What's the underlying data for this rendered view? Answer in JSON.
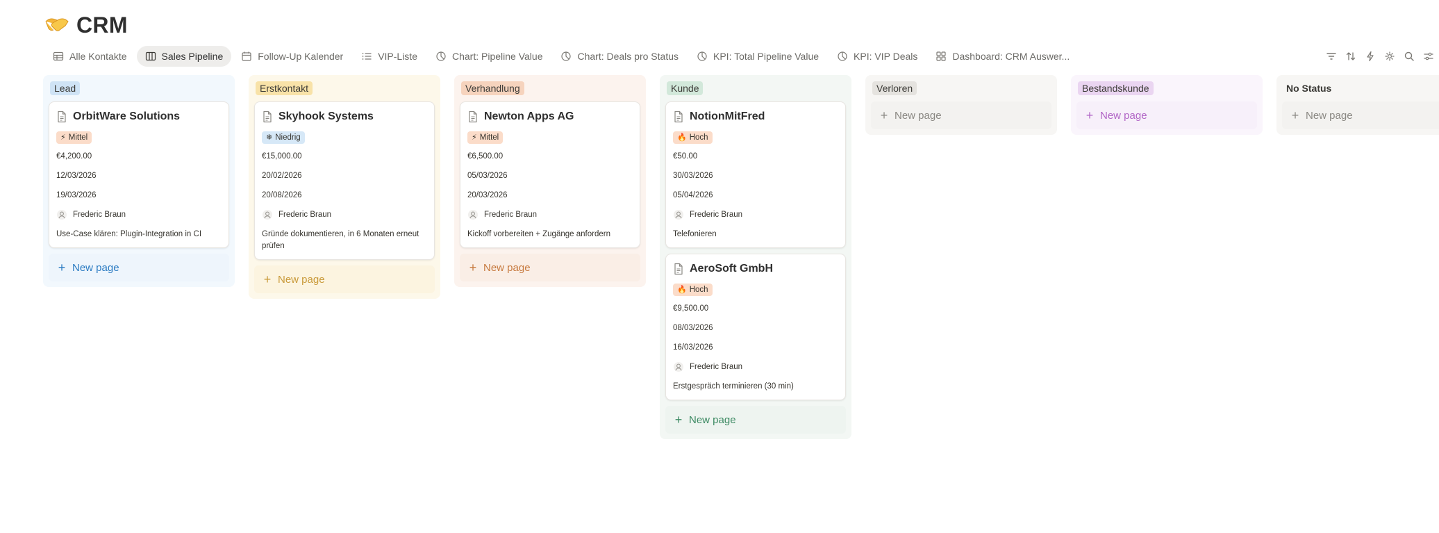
{
  "page": {
    "title": "CRM",
    "icon": "handshake-emoji"
  },
  "tabs": [
    {
      "label": "Alle Kontakte",
      "icon": "table-icon",
      "active": false
    },
    {
      "label": "Sales Pipeline",
      "icon": "board-icon",
      "active": true
    },
    {
      "label": "Follow-Up Kalender",
      "icon": "calendar-icon",
      "active": false
    },
    {
      "label": "VIP-Liste",
      "icon": "list-icon",
      "active": false
    },
    {
      "label": "Chart: Pipeline Value",
      "icon": "chart-icon",
      "active": false
    },
    {
      "label": "Chart: Deals pro Status",
      "icon": "chart-icon",
      "active": false
    },
    {
      "label": "KPI: Total Pipeline Value",
      "icon": "chart-icon",
      "active": false
    },
    {
      "label": "KPI: VIP Deals",
      "icon": "chart-icon",
      "active": false
    },
    {
      "label": "Dashboard: CRM Auswer...",
      "icon": "dashboard-icon",
      "active": false
    }
  ],
  "toolbar": [
    "filter-icon",
    "sort-icon",
    "automation-icon",
    "settings-sparkle-icon",
    "search-icon",
    "view-settings-icon"
  ],
  "colors": {
    "priority_mittel_bg": "#fbdcc9",
    "priority_niedrig_bg": "#d6e8f7",
    "priority_hoch_bg": "#fbdcc9",
    "newpage_lead": "#2b7bc2",
    "newpage_erstkontakt": "#c99a3a",
    "newpage_verhandlung": "#c77a3f",
    "newpage_kunde": "#3d8a63",
    "newpage_verloren": "#8a8883",
    "newpage_bestandskunde": "#b165c6",
    "newpage_nostatus": "#8a8883"
  },
  "board": {
    "columns": [
      {
        "status": "Lead",
        "label_bg": "#cfe3f5",
        "col_bg": "#f2f8fd",
        "new_page": "New page",
        "new_color": "#2b7bc2",
        "new_bg": "#eef5fc",
        "cards": [
          {
            "title": "OrbitWare Solutions",
            "priority": "Mittel",
            "priority_icon": "⚡",
            "priority_bg": "#fbdcc9",
            "value": "€4,200.00",
            "date1": "12/03/2026",
            "date2": "19/03/2026",
            "owner": "Frederic Braun",
            "note": "Use-Case klären: Plugin-Integration in CI"
          }
        ]
      },
      {
        "status": "Erstkontakt",
        "label_bg": "#f8e2a8",
        "col_bg": "#fdf8ea",
        "new_page": "New page",
        "new_color": "#c99a3a",
        "new_bg": "#fcf4e0",
        "cards": [
          {
            "title": "Skyhook Systems",
            "priority": "Niedrig",
            "priority_icon": "❄",
            "priority_bg": "#d6e8f7",
            "value": "€15,000.00",
            "date1": "20/02/2026",
            "date2": "20/08/2026",
            "owner": "Frederic Braun",
            "note": "Gründe dokumentieren, in 6 Monaten erneut prüfen"
          }
        ]
      },
      {
        "status": "Verhandlung",
        "label_bg": "#f6d3bd",
        "col_bg": "#fcf3ee",
        "new_page": "New page",
        "new_color": "#c77a3f",
        "new_bg": "#faeee6",
        "cards": [
          {
            "title": "Newton Apps AG",
            "priority": "Mittel",
            "priority_icon": "⚡",
            "priority_bg": "#fbdcc9",
            "value": "€6,500.00",
            "date1": "05/03/2026",
            "date2": "20/03/2026",
            "owner": "Frederic Braun",
            "note": "Kickoff vorbereiten + Zugänge anfordern"
          }
        ]
      },
      {
        "status": "Kunde",
        "label_bg": "#d2e8da",
        "col_bg": "#f3f7f4",
        "new_page": "New page",
        "new_color": "#3d8a63",
        "new_bg": "#eef4f0",
        "cards": [
          {
            "title": "NotionMitFred",
            "priority": "Hoch",
            "priority_icon": "🔥",
            "priority_bg": "#fbdcc9",
            "value": "€50.00",
            "date1": "30/03/2026",
            "date2": "05/04/2026",
            "owner": "Frederic Braun",
            "note": "Telefonieren"
          },
          {
            "title": "AeroSoft GmbH",
            "priority": "Hoch",
            "priority_icon": "🔥",
            "priority_bg": "#fbdcc9",
            "value": "€9,500.00",
            "date1": "08/03/2026",
            "date2": "16/03/2026",
            "owner": "Frederic Braun",
            "note": "Erstgespräch terminieren (30 min)"
          }
        ]
      },
      {
        "status": "Verloren",
        "label_bg": "#e5e3df",
        "col_bg": "#f7f6f4",
        "new_page": "New page",
        "new_color": "#8a8883",
        "new_bg": "#f3f2f0",
        "cards": []
      },
      {
        "status": "Bestandskunde",
        "label_bg": "#ead5f1",
        "col_bg": "#faf5fc",
        "new_page": "New page",
        "new_color": "#b165c6",
        "new_bg": "#f7f0fa",
        "cards": []
      },
      {
        "status": "No Status",
        "label_bg": "transparent",
        "col_bg": "#f7f6f4",
        "new_page": "New page",
        "new_color": "#8a8883",
        "new_bg": "#f3f2f0",
        "cards": [],
        "plain": true
      }
    ]
  }
}
